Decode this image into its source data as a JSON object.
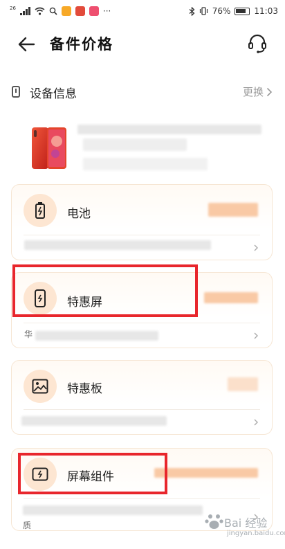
{
  "status_bar": {
    "network": "26",
    "battery_percent": "76%",
    "time": "11:03",
    "more_dots": "···"
  },
  "header": {
    "title": "备件价格"
  },
  "device": {
    "label": "设备信息",
    "change_link": "更换",
    "phone_color": "#e8452a"
  },
  "parts": [
    {
      "name": "电池",
      "icon": "battery-icon",
      "footer_text": ""
    },
    {
      "name": "特惠屏",
      "icon": "phone-screen-icon",
      "footer_text": "华"
    },
    {
      "name": "特惠板",
      "icon": "image-icon",
      "footer_text": ""
    },
    {
      "name": "屏幕组件",
      "icon": "screen-assembly-icon",
      "footer_text": "质"
    }
  ],
  "highlight_color": "#e8262c",
  "accent_icon_bg": "#fde6d2",
  "watermark": {
    "line1": "Bai 经验",
    "line2": "jingyan.baidu.com"
  }
}
